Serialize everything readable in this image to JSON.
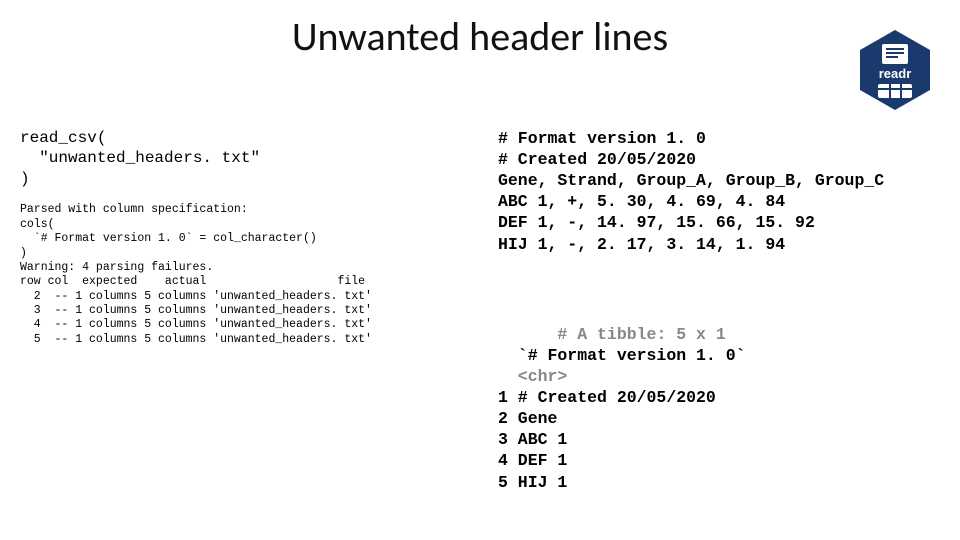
{
  "title": "Unwanted header lines",
  "logo": {
    "name": "readr",
    "brand_color": "#1a3a6e",
    "accent": "#ffffff"
  },
  "left": {
    "code_call": "read_csv(\n  \"unwanted_headers. txt\"\n)",
    "parse_output": "Parsed with column specification:\ncols(\n  `# Format version 1. 0` = col_character()\n)\nWarning: 4 parsing failures.\nrow col  expected    actual                   file\n  2  -- 1 columns 5 columns 'unwanted_headers. txt'\n  3  -- 1 columns 5 columns 'unwanted_headers. txt'\n  4  -- 1 columns 5 columns 'unwanted_headers. txt'\n  5  -- 1 columns 5 columns 'unwanted_headers. txt'"
  },
  "right": {
    "file_contents": "# Format version 1. 0\n# Created 20/05/2020\nGene, Strand, Group_A, Group_B, Group_C\nABC 1, +, 5. 30, 4. 69, 4. 84\nDEF 1, -, 14. 97, 15. 66, 15. 92\nHIJ 1, -, 2. 17, 3. 14, 1. 94",
    "tibble_header": "# A tibble: 5 x 1",
    "tibble_colname": "  `# Format version 1. 0`",
    "tibble_type": "  <chr>",
    "tibble_rows": "1 # Created 20/05/2020\n2 Gene\n3 ABC 1\n4 DEF 1\n5 HIJ 1"
  }
}
